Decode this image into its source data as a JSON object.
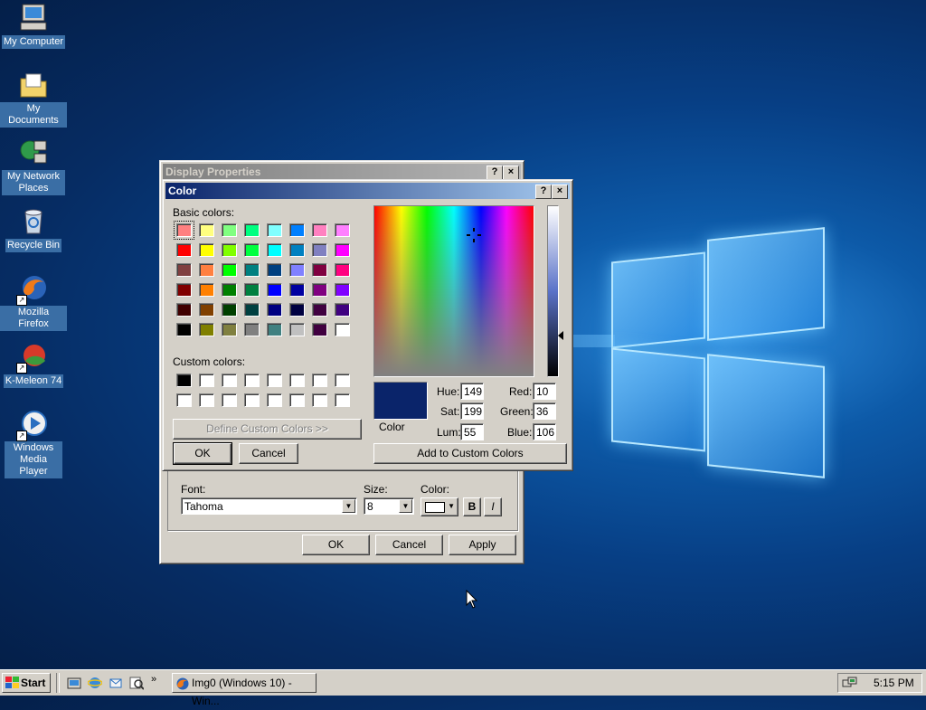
{
  "desktop": {
    "icons": [
      {
        "label": "My Computer",
        "icon": "computer-icon"
      },
      {
        "label": "My Documents",
        "icon": "folder-icon"
      },
      {
        "label": "My Network Places",
        "icon": "network-icon"
      },
      {
        "label": "Recycle Bin",
        "icon": "recycle-bin-icon"
      },
      {
        "label": "Mozilla Firefox",
        "icon": "firefox-icon"
      },
      {
        "label": "K-Meleon 74",
        "icon": "kmeleon-icon"
      },
      {
        "label": "Windows Media Player",
        "icon": "media-player-icon"
      }
    ]
  },
  "display_properties": {
    "title": "Display Properties",
    "font_label": "Font:",
    "font_value": "Tahoma",
    "size_label": "Size:",
    "size_value": "8",
    "color_label": "Color:",
    "bold_label": "B",
    "italic_label": "I",
    "ok": "OK",
    "cancel": "Cancel",
    "apply": "Apply"
  },
  "color_dialog": {
    "title": "Color",
    "help": "?",
    "close": "×",
    "basic_colors_label": "Basic colors:",
    "custom_colors_label": "Custom colors:",
    "define_custom": "Define Custom Colors >>",
    "ok": "OK",
    "cancel": "Cancel",
    "add_custom": "Add to Custom Colors",
    "color_label": "Color",
    "hue_label": "Hue:",
    "hue": "149",
    "sat_label": "Sat:",
    "sat": "199",
    "lum_label": "Lum:",
    "lum": "55",
    "red_label": "Red:",
    "red": "10",
    "green_label": "Green:",
    "green": "36",
    "blue_label": "Blue:",
    "blue": "106",
    "preview_color": "#0a246a",
    "basic_colors": [
      [
        "#ff8080",
        "#ffff80",
        "#80ff80",
        "#00ff80",
        "#80ffff",
        "#0080ff",
        "#ff80c0",
        "#ff80ff"
      ],
      [
        "#ff0000",
        "#ffff00",
        "#80ff00",
        "#00ff40",
        "#00ffff",
        "#0080c0",
        "#8080c0",
        "#ff00ff"
      ],
      [
        "#804040",
        "#ff8040",
        "#00ff00",
        "#008080",
        "#004080",
        "#8080ff",
        "#800040",
        "#ff0080"
      ],
      [
        "#800000",
        "#ff8000",
        "#008000",
        "#008040",
        "#0000ff",
        "#0000a0",
        "#800080",
        "#8000ff"
      ],
      [
        "#400000",
        "#804000",
        "#004000",
        "#004040",
        "#000080",
        "#000040",
        "#400040",
        "#400080"
      ],
      [
        "#000000",
        "#808000",
        "#808040",
        "#808080",
        "#408080",
        "#c0c0c0",
        "#400040",
        "#ffffff"
      ]
    ],
    "custom_colors": [
      [
        "#000000",
        "#ffffff",
        "#ffffff",
        "#ffffff",
        "#ffffff",
        "#ffffff",
        "#ffffff",
        "#ffffff"
      ],
      [
        "#ffffff",
        "#ffffff",
        "#ffffff",
        "#ffffff",
        "#ffffff",
        "#ffffff",
        "#ffffff",
        "#ffffff"
      ]
    ]
  },
  "taskbar": {
    "start": "Start",
    "task": "Img0 (Windows 10) - Win...",
    "clock": "5:15 PM"
  }
}
